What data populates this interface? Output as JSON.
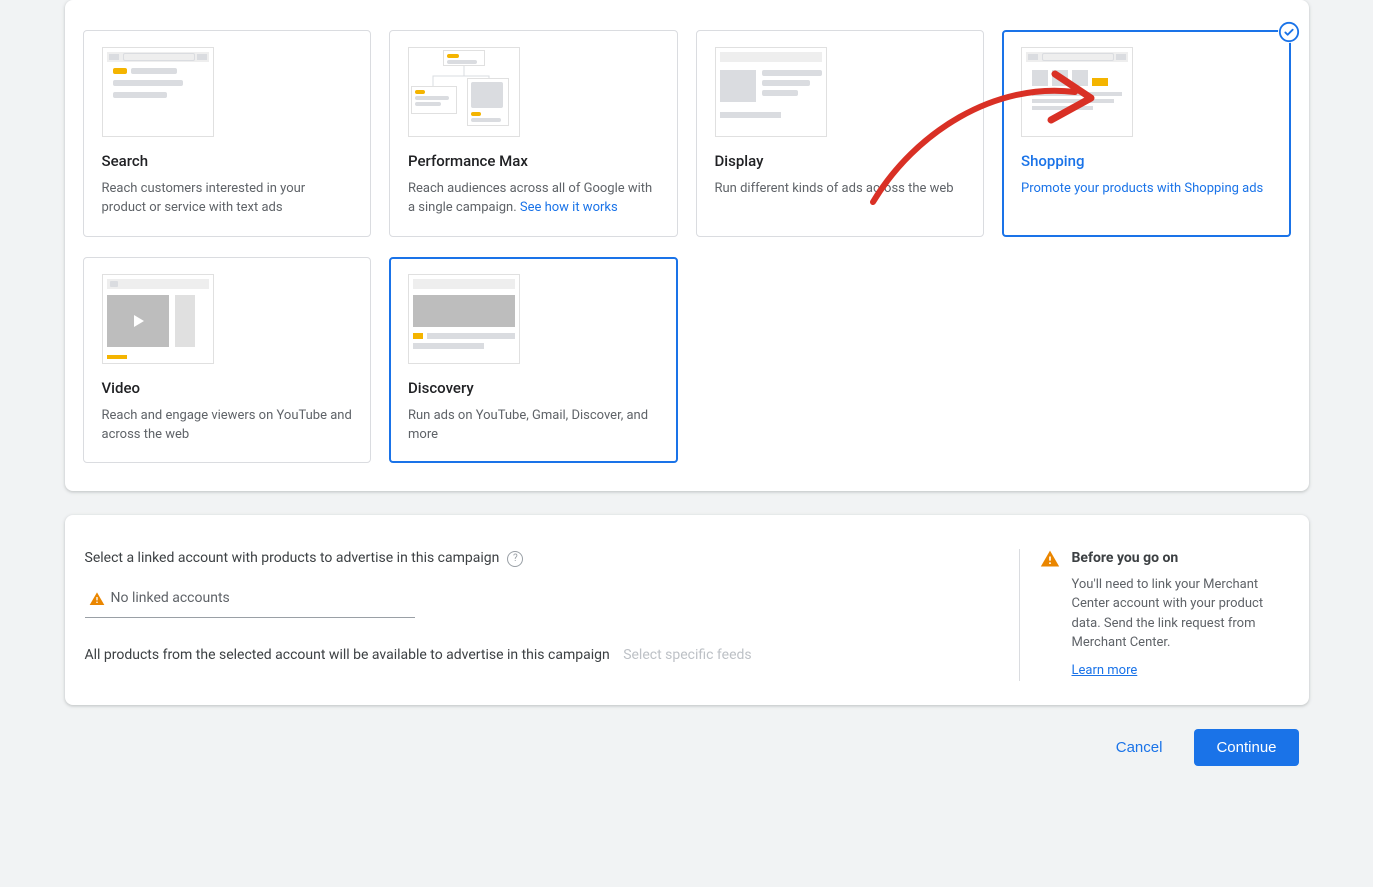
{
  "campaign_types": {
    "search": {
      "title": "Search",
      "desc": "Reach customers interested in your product or service with text ads"
    },
    "pmax": {
      "title": "Performance Max",
      "desc": "Reach audiences across all of Google with a single campaign. ",
      "link": "See how it works"
    },
    "display": {
      "title": "Display",
      "desc": "Run different kinds of ads across the web"
    },
    "shopping": {
      "title": "Shopping",
      "desc": "Promote your products with Shopping ads"
    },
    "video": {
      "title": "Video",
      "desc": "Reach and engage viewers on YouTube and across the web"
    },
    "discovery": {
      "title": "Discovery",
      "desc": "Run ads on YouTube, Gmail, Discover, and more"
    }
  },
  "linked": {
    "label": "Select a linked account with products to advertise in this campaign",
    "dropdown_value": "No linked accounts",
    "subtext": "All products from the selected account will be available to advertise in this campaign",
    "subtext_disabled": "Select specific feeds"
  },
  "before": {
    "title": "Before you go on",
    "body": "You'll need to link your Merchant Center account with your product data. Send the link request from Merchant Center.",
    "link": "Learn more"
  },
  "actions": {
    "cancel": "Cancel",
    "continue": "Continue"
  }
}
